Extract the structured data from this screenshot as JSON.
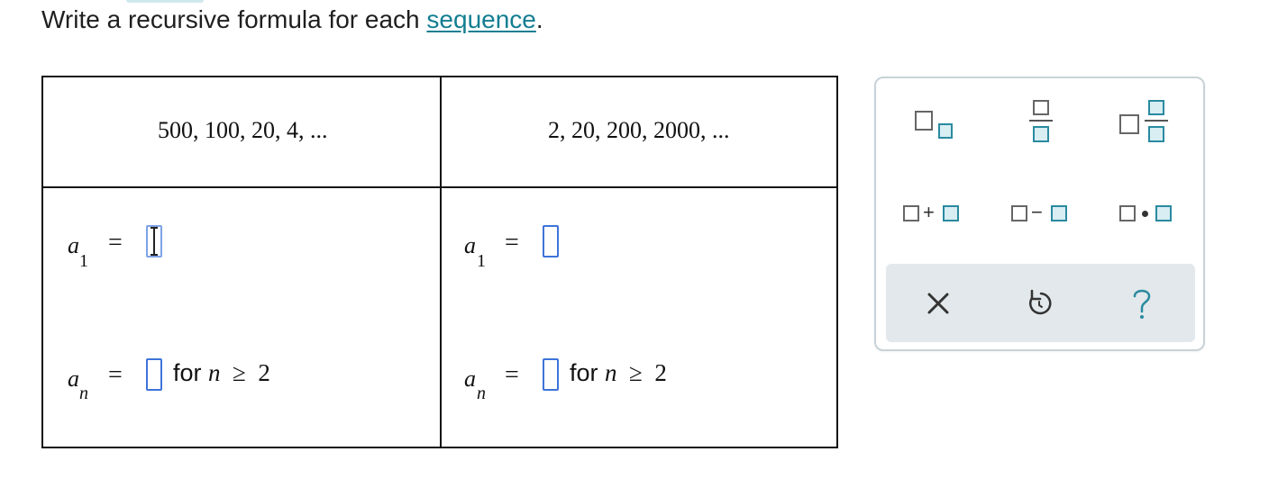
{
  "prompt": {
    "text": "Write a recursive formula for each ",
    "link": "sequence",
    "end": "."
  },
  "columns": [
    {
      "sequence": "500, 100, 20, 4, ...",
      "first_term": {
        "var": "a",
        "sub": "1",
        "eq": "="
      },
      "recursive": {
        "var": "a",
        "sub": "n",
        "eq": "=",
        "for": "for",
        "cond_var": "n",
        "cond_op": "≥",
        "cond_val": "2"
      }
    },
    {
      "sequence": "2, 20, 200, 2000, ...",
      "first_term": {
        "var": "a",
        "sub": "1",
        "eq": "="
      },
      "recursive": {
        "var": "a",
        "sub": "n",
        "eq": "=",
        "for": "for",
        "cond_var": "n",
        "cond_op": "≥",
        "cond_val": "2"
      }
    }
  ],
  "toolbar": {
    "tools": [
      "subscript-tool",
      "fraction-tool",
      "mixed-number-tool",
      "addition-tool",
      "subtraction-tool",
      "multiplication-tool"
    ],
    "ops": {
      "plus": "+",
      "minus": "−"
    },
    "actions": [
      "clear",
      "undo",
      "help"
    ],
    "colors": {
      "accent": "#2a8aa0",
      "input_border": "#3e74d9",
      "link": "#137e92"
    }
  }
}
